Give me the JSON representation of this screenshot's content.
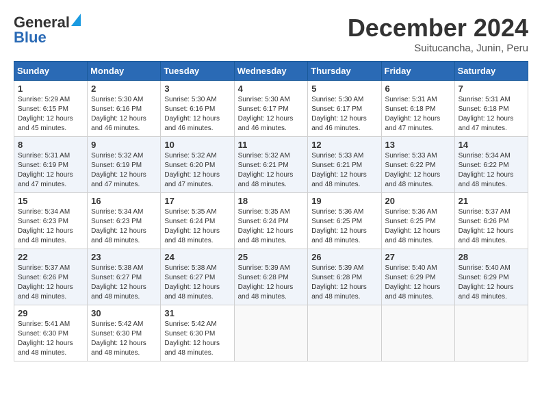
{
  "header": {
    "logo_line1": "General",
    "logo_line2": "Blue",
    "month": "December 2024",
    "location": "Suitucancha, Junin, Peru"
  },
  "days_of_week": [
    "Sunday",
    "Monday",
    "Tuesday",
    "Wednesday",
    "Thursday",
    "Friday",
    "Saturday"
  ],
  "weeks": [
    [
      {
        "day": "1",
        "info": "Sunrise: 5:29 AM\nSunset: 6:15 PM\nDaylight: 12 hours\nand 45 minutes."
      },
      {
        "day": "2",
        "info": "Sunrise: 5:30 AM\nSunset: 6:16 PM\nDaylight: 12 hours\nand 46 minutes."
      },
      {
        "day": "3",
        "info": "Sunrise: 5:30 AM\nSunset: 6:16 PM\nDaylight: 12 hours\nand 46 minutes."
      },
      {
        "day": "4",
        "info": "Sunrise: 5:30 AM\nSunset: 6:17 PM\nDaylight: 12 hours\nand 46 minutes."
      },
      {
        "day": "5",
        "info": "Sunrise: 5:30 AM\nSunset: 6:17 PM\nDaylight: 12 hours\nand 46 minutes."
      },
      {
        "day": "6",
        "info": "Sunrise: 5:31 AM\nSunset: 6:18 PM\nDaylight: 12 hours\nand 47 minutes."
      },
      {
        "day": "7",
        "info": "Sunrise: 5:31 AM\nSunset: 6:18 PM\nDaylight: 12 hours\nand 47 minutes."
      }
    ],
    [
      {
        "day": "8",
        "info": "Sunrise: 5:31 AM\nSunset: 6:19 PM\nDaylight: 12 hours\nand 47 minutes."
      },
      {
        "day": "9",
        "info": "Sunrise: 5:32 AM\nSunset: 6:19 PM\nDaylight: 12 hours\nand 47 minutes."
      },
      {
        "day": "10",
        "info": "Sunrise: 5:32 AM\nSunset: 6:20 PM\nDaylight: 12 hours\nand 47 minutes."
      },
      {
        "day": "11",
        "info": "Sunrise: 5:32 AM\nSunset: 6:21 PM\nDaylight: 12 hours\nand 48 minutes."
      },
      {
        "day": "12",
        "info": "Sunrise: 5:33 AM\nSunset: 6:21 PM\nDaylight: 12 hours\nand 48 minutes."
      },
      {
        "day": "13",
        "info": "Sunrise: 5:33 AM\nSunset: 6:22 PM\nDaylight: 12 hours\nand 48 minutes."
      },
      {
        "day": "14",
        "info": "Sunrise: 5:34 AM\nSunset: 6:22 PM\nDaylight: 12 hours\nand 48 minutes."
      }
    ],
    [
      {
        "day": "15",
        "info": "Sunrise: 5:34 AM\nSunset: 6:23 PM\nDaylight: 12 hours\nand 48 minutes."
      },
      {
        "day": "16",
        "info": "Sunrise: 5:34 AM\nSunset: 6:23 PM\nDaylight: 12 hours\nand 48 minutes."
      },
      {
        "day": "17",
        "info": "Sunrise: 5:35 AM\nSunset: 6:24 PM\nDaylight: 12 hours\nand 48 minutes."
      },
      {
        "day": "18",
        "info": "Sunrise: 5:35 AM\nSunset: 6:24 PM\nDaylight: 12 hours\nand 48 minutes."
      },
      {
        "day": "19",
        "info": "Sunrise: 5:36 AM\nSunset: 6:25 PM\nDaylight: 12 hours\nand 48 minutes."
      },
      {
        "day": "20",
        "info": "Sunrise: 5:36 AM\nSunset: 6:25 PM\nDaylight: 12 hours\nand 48 minutes."
      },
      {
        "day": "21",
        "info": "Sunrise: 5:37 AM\nSunset: 6:26 PM\nDaylight: 12 hours\nand 48 minutes."
      }
    ],
    [
      {
        "day": "22",
        "info": "Sunrise: 5:37 AM\nSunset: 6:26 PM\nDaylight: 12 hours\nand 48 minutes."
      },
      {
        "day": "23",
        "info": "Sunrise: 5:38 AM\nSunset: 6:27 PM\nDaylight: 12 hours\nand 48 minutes."
      },
      {
        "day": "24",
        "info": "Sunrise: 5:38 AM\nSunset: 6:27 PM\nDaylight: 12 hours\nand 48 minutes."
      },
      {
        "day": "25",
        "info": "Sunrise: 5:39 AM\nSunset: 6:28 PM\nDaylight: 12 hours\nand 48 minutes."
      },
      {
        "day": "26",
        "info": "Sunrise: 5:39 AM\nSunset: 6:28 PM\nDaylight: 12 hours\nand 48 minutes."
      },
      {
        "day": "27",
        "info": "Sunrise: 5:40 AM\nSunset: 6:29 PM\nDaylight: 12 hours\nand 48 minutes."
      },
      {
        "day": "28",
        "info": "Sunrise: 5:40 AM\nSunset: 6:29 PM\nDaylight: 12 hours\nand 48 minutes."
      }
    ],
    [
      {
        "day": "29",
        "info": "Sunrise: 5:41 AM\nSunset: 6:30 PM\nDaylight: 12 hours\nand 48 minutes."
      },
      {
        "day": "30",
        "info": "Sunrise: 5:42 AM\nSunset: 6:30 PM\nDaylight: 12 hours\nand 48 minutes."
      },
      {
        "day": "31",
        "info": "Sunrise: 5:42 AM\nSunset: 6:30 PM\nDaylight: 12 hours\nand 48 minutes."
      },
      null,
      null,
      null,
      null
    ]
  ]
}
